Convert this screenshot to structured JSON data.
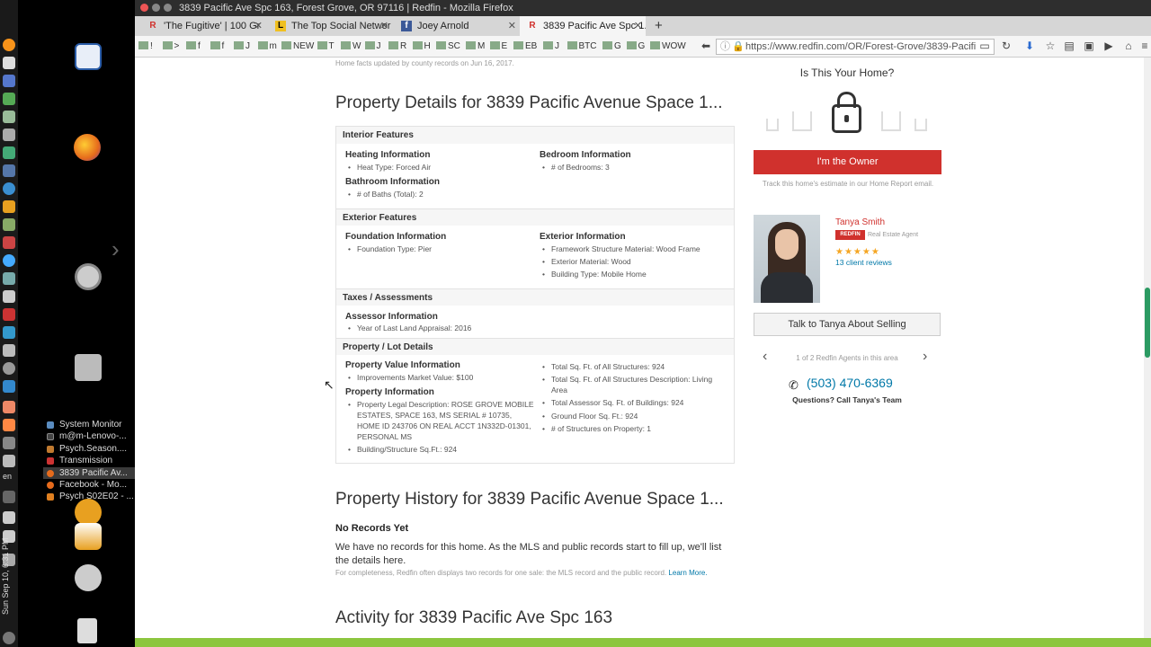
{
  "os": {
    "clock": "Sun Sep 10, 6:31 PM",
    "keyboard": "en"
  },
  "taskbar": {
    "items": [
      {
        "label": "System Monitor",
        "color": "#5a8cc0"
      },
      {
        "label": "m@m-Lenovo-...",
        "color": "#444"
      },
      {
        "label": "Psych.Season....",
        "color": "#c07a30"
      },
      {
        "label": "Transmission",
        "color": "#c33"
      },
      {
        "label": "3839 Pacific Av...",
        "color": "#e66b1c"
      },
      {
        "label": "Facebook - Mo...",
        "color": "#e66b1c"
      },
      {
        "label": "Psych S02E02 - ...",
        "color": "#e08020"
      }
    ]
  },
  "window": {
    "title": "3839 Pacific Ave Spc 163, Forest Grove, OR 97116 | Redfin - Mozilla Firefox"
  },
  "tabs": [
    {
      "label": "'The Fugitive' | 100 Gr",
      "favicon": "R"
    },
    {
      "label": "The Top Social Networ",
      "favicon": "L"
    },
    {
      "label": "Joey Arnold",
      "favicon": "f"
    },
    {
      "label": "3839 Pacific Ave Spc 1...",
      "favicon": "R"
    }
  ],
  "bookmarks": [
    "!",
    ">",
    "f",
    "f",
    "J",
    "m",
    "NEW",
    "T",
    "W",
    "J",
    "R",
    "H",
    "SC",
    "M",
    "E",
    "EB",
    "J",
    "BTC",
    "G",
    "G",
    "WOW"
  ],
  "url": "https://www.redfin.com/OR/Forest-Grove/3839-Pacifi",
  "page": {
    "facts_updated": "Home facts updated by county records on Jun 16, 2017.",
    "details_title": "Property Details for 3839 Pacific Avenue Space 1...",
    "interior_features": "Interior Features",
    "heating_info": "Heating Information",
    "heat_type": "Heat Type: Forced Air",
    "bedroom_info": "Bedroom Information",
    "bedrooms": "# of Bedrooms: 3",
    "bathroom_info": "Bathroom Information",
    "baths": "# of Baths (Total): 2",
    "exterior_features": "Exterior Features",
    "foundation_info": "Foundation Information",
    "foundation_type": "Foundation Type: Pier",
    "exterior_info": "Exterior Information",
    "framework": "Framework Structure Material: Wood Frame",
    "exterior_material": "Exterior Material: Wood",
    "building_type": "Building Type: Mobile Home",
    "taxes": "Taxes / Assessments",
    "assessor_info": "Assessor Information",
    "appraisal": "Year of Last Land Appraisal: 2016",
    "lot_details": "Property / Lot Details",
    "value_info": "Property Value Information",
    "improvements": "Improvements Market Value: $100",
    "property_info": "Property Information",
    "legal_desc": "Property Legal Description: ROSE GROVE MOBILE ESTATES, SPACE 163, MS SERIAL # 10735, HOME ID 243706 ON REAL ACCT 1N332D-01301, PERSONAL MS",
    "building_sqft": "Building/Structure Sq.Ft.: 924",
    "total_sqft": "Total Sq. Ft. of All Structures: 924",
    "total_sqft_desc": "Total Sq. Ft. of All Structures Description: Living Area",
    "assessor_sqft": "Total Assessor Sq. Ft. of Buildings: 924",
    "ground_floor": "Ground Floor Sq. Ft.: 924",
    "structures": "# of Structures on Property: 1",
    "history_title": "Property History for 3839 Pacific Avenue Space 1...",
    "no_records": "No Records Yet",
    "no_records_text": "We have no records for this home. As the MLS and public records start to fill up, we'll list the details here.",
    "completeness": "For completeness, Redfin often displays two records for one sale: the MLS record and the public record.",
    "learn_more": "Learn More.",
    "activity_title": "Activity for 3839 Pacific Ave Spc 163"
  },
  "sidebar": {
    "is_this_your_home": "Is This Your Home?",
    "owner_button": "I'm the Owner",
    "track_text": "Track this home's estimate in our Home Report email.",
    "agent_name": "Tanya Smith",
    "badge": "REDFIN",
    "agent_role": "Real Estate Agent",
    "stars": "★★★★★",
    "reviews": "13 client reviews",
    "talk_button": "Talk to Tanya About Selling",
    "pager": "1 of 2 Redfin Agents in this area",
    "phone": "(503) 470-6369",
    "call": "Questions? Call Tanya's Team"
  },
  "colors": {
    "redfin_red": "#d0312d",
    "link_blue": "#0078a8"
  }
}
